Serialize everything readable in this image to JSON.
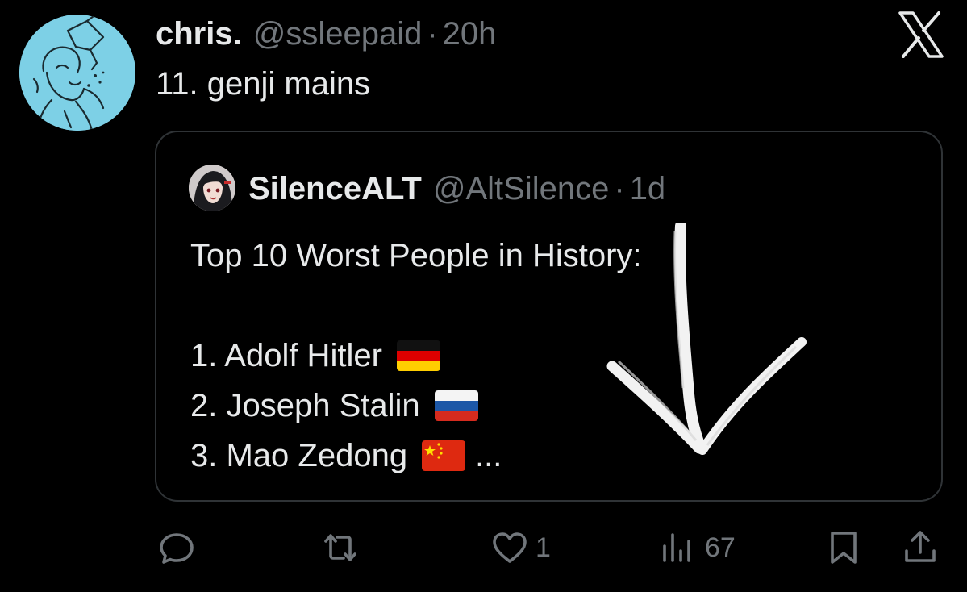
{
  "tweet": {
    "display_name": "chris.",
    "handle": "@ssleepaid",
    "separator": "·",
    "time": "20h",
    "text": "11. genji mains"
  },
  "quoted_tweet": {
    "display_name": "SilenceALT",
    "handle": "@AltSilence",
    "separator": "·",
    "time": "1d",
    "title": "Top 10 Worst People in History:",
    "items": [
      {
        "text": "1. Adolf Hitler",
        "flag": "germany-flag"
      },
      {
        "text": "2. Joseph Stalin",
        "flag": "russia-flag"
      },
      {
        "text": "3. Mao Zedong",
        "flag": "china-flag"
      }
    ],
    "truncation": "..."
  },
  "actions": {
    "reply": {
      "icon": "reply-icon",
      "count": ""
    },
    "retweet": {
      "icon": "retweet-icon",
      "count": ""
    },
    "like": {
      "icon": "heart-icon",
      "count": "1"
    },
    "views": {
      "icon": "views-icon",
      "count": "67"
    },
    "bookmark": {
      "icon": "bookmark-icon"
    },
    "share": {
      "icon": "share-icon"
    }
  },
  "colors": {
    "background": "#000000",
    "primary_text": "#e7e9ea",
    "secondary_text": "#71767b",
    "card_border": "#2f3336",
    "avatar_bg": "#7dd0e6"
  }
}
